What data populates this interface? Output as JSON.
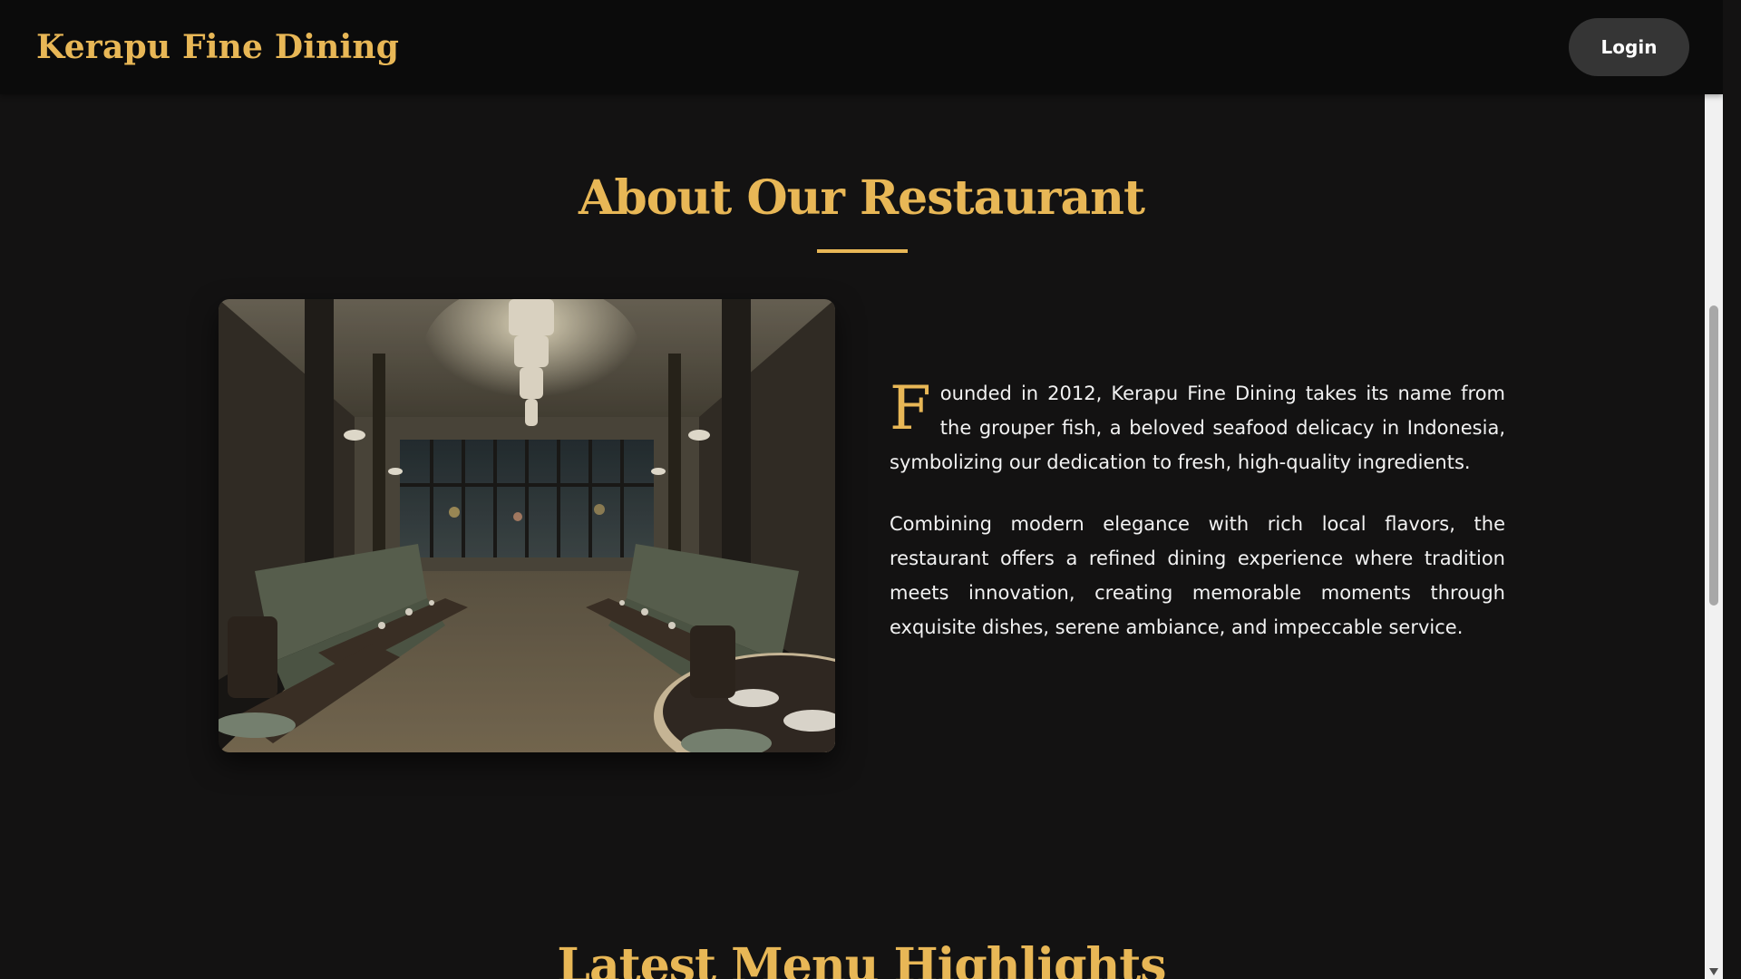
{
  "header": {
    "brand": "Kerapu Fine Dining",
    "login_label": "Login"
  },
  "about": {
    "title": "About Our Restaurant",
    "drop_cap": "F",
    "paragraph1_rest": "ounded in 2012, Kerapu Fine Dining takes its name from the grouper fish, a beloved seafood delicacy in Indonesia, symbolizing our dedication to fresh, high-quality ingredients.",
    "paragraph2": "Combining modern elegance with rich local flavors, the restaurant offers a refined dining experience where tradition meets innovation, creating memorable moments through exquisite dishes, serene ambiance, and impeccable service."
  },
  "menu": {
    "title": "Latest Menu Highlights"
  },
  "icons": {
    "scroll_up": "triangle-up-icon",
    "scroll_down": "triangle-down-icon"
  },
  "colors": {
    "accent": "#e8b756",
    "background": "#131212",
    "header": "#0b0b0b",
    "button": "#353535"
  }
}
